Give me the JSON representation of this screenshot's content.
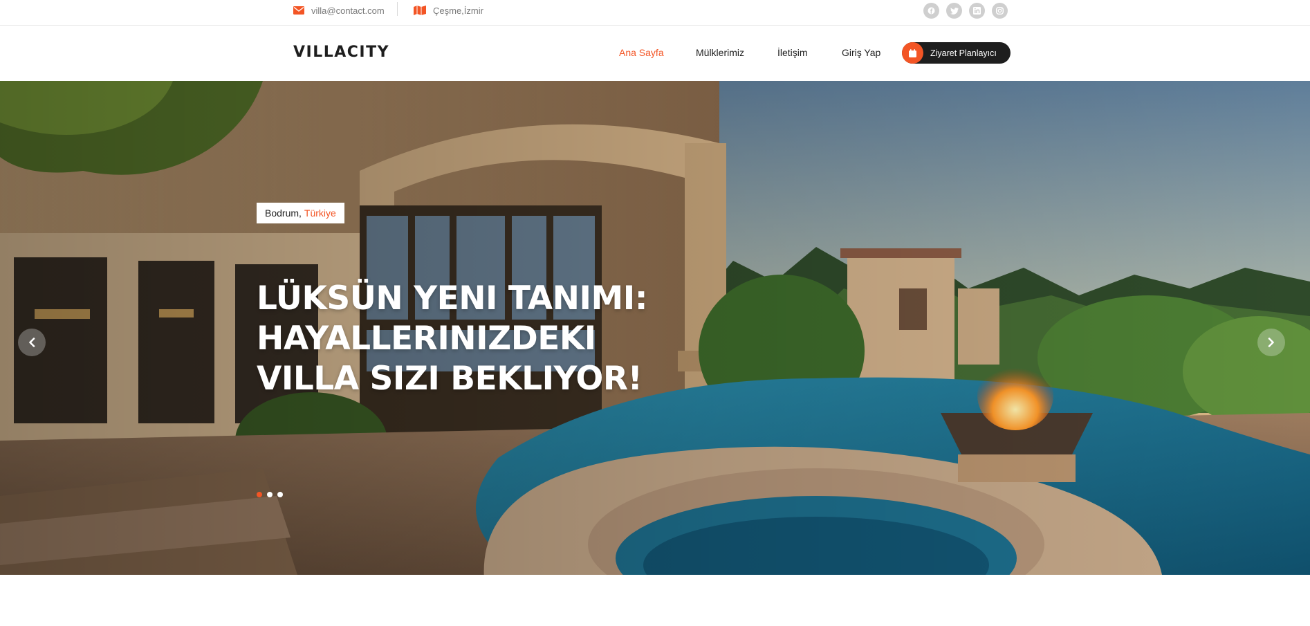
{
  "topbar": {
    "email": "villa@contact.com",
    "location": "Çeşme,İzmir",
    "email_icon": "envelope-icon",
    "location_icon": "map-icon",
    "socials": [
      "facebook-icon",
      "twitter-icon",
      "linkedin-icon",
      "instagram-icon"
    ]
  },
  "nav": {
    "logo": "VILLACITY",
    "items": [
      "Ana Sayfa",
      "Mülklerimiz",
      "İletişim",
      "Giriş Yap"
    ],
    "active_item": "Ana Sayfa",
    "cta_label": "Ziyaret Planlayıcı",
    "cta_icon": "calendar-icon"
  },
  "hero": {
    "city": "Bodrum",
    "separator": ",",
    "country": "Türkiye",
    "headline_lines": [
      "LÜKSÜN YENI TANIMI:",
      "HAYALLERINIZDEKI",
      "VILLA SIZI BEKLIYOR!"
    ],
    "slide_count": 3,
    "active_slide": 1,
    "prev_icon": "chevron-left-icon",
    "next_icon": "chevron-right-icon"
  },
  "colors": {
    "accent": "#f35525",
    "dark": "#1e1e1e",
    "muted_text": "#7a7a7a",
    "social_bg": "#cfcfcf"
  }
}
